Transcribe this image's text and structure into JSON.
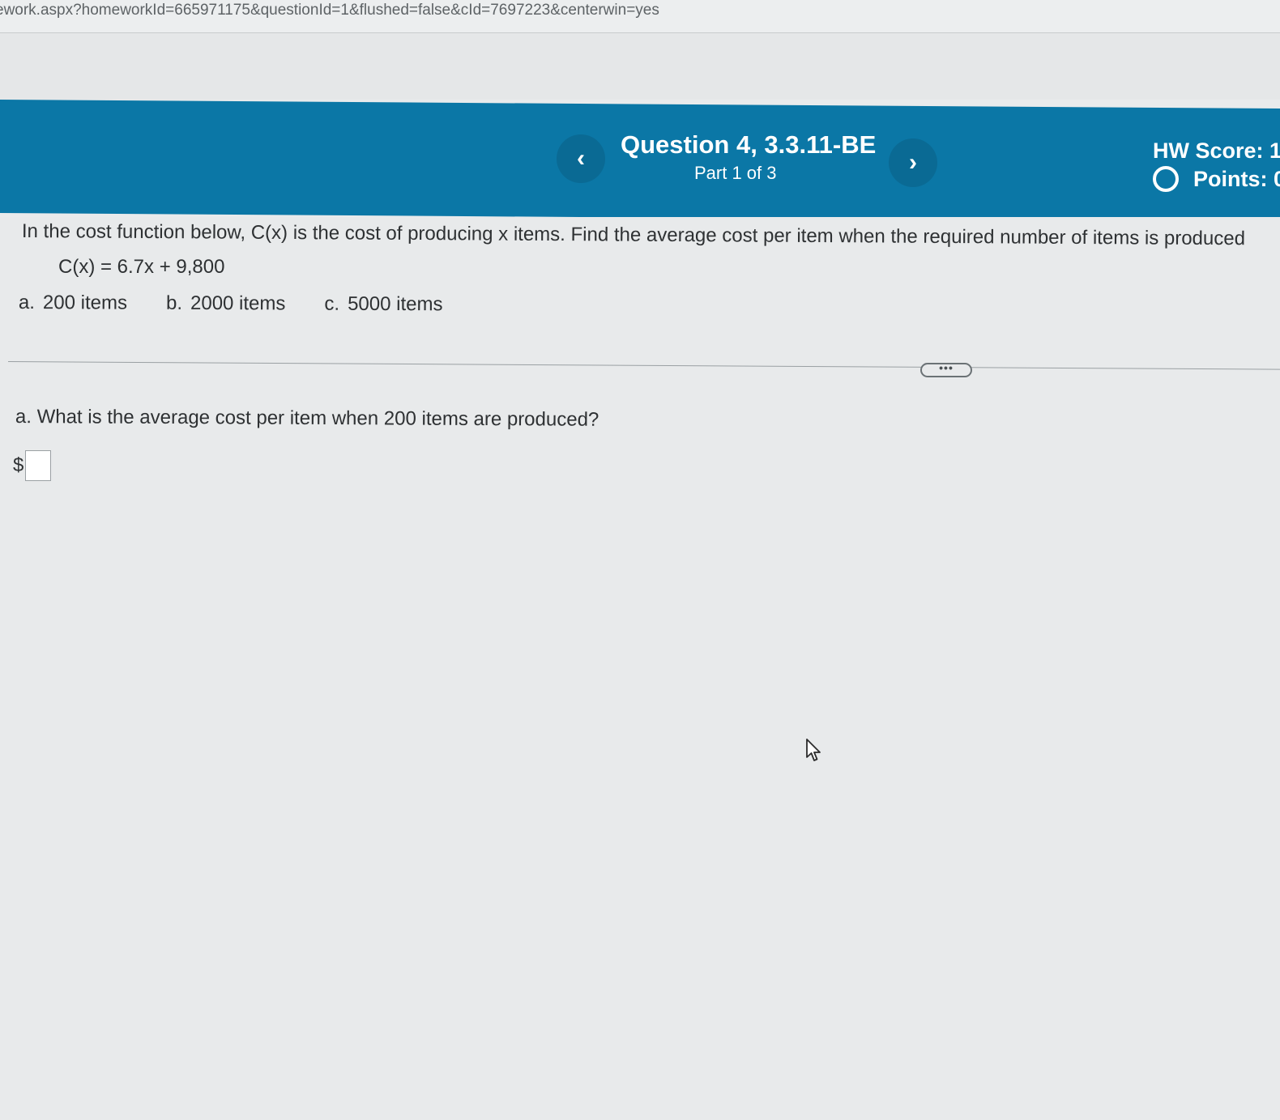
{
  "browser": {
    "url": "ework.aspx?homeworkId=665971175&questionId=1&flushed=false&cId=7697223&centerwin=yes"
  },
  "header": {
    "prev_icon": "chevron-left-icon",
    "prev_label": "‹",
    "next_icon": "chevron-right-icon",
    "next_label": "›",
    "question_title": "Question 4, 3.3.11-BE",
    "part_label": "Part 1 of 3",
    "hw_score_label": "HW Score: 1",
    "points_label": "Points: 0",
    "points_icon": "circle-outline-icon",
    "bg_color": "#0b77a6"
  },
  "problem": {
    "prompt": "In the cost function below, C(x) is the cost of producing x items. Find the average cost per item when the required number of items is produced",
    "formula": "C(x) = 6.7x + 9,800",
    "parts": [
      {
        "letter": "a.",
        "text": "200 items"
      },
      {
        "letter": "b.",
        "text": "2000 items"
      },
      {
        "letter": "c.",
        "text": "5000 items"
      }
    ]
  },
  "divider": {
    "more_label": "•••"
  },
  "question_a": {
    "text": "a. What is the average cost per item when 200 items are produced?",
    "currency": "$",
    "answer_value": ""
  },
  "cursor": {
    "icon": "mouse-pointer-icon"
  }
}
